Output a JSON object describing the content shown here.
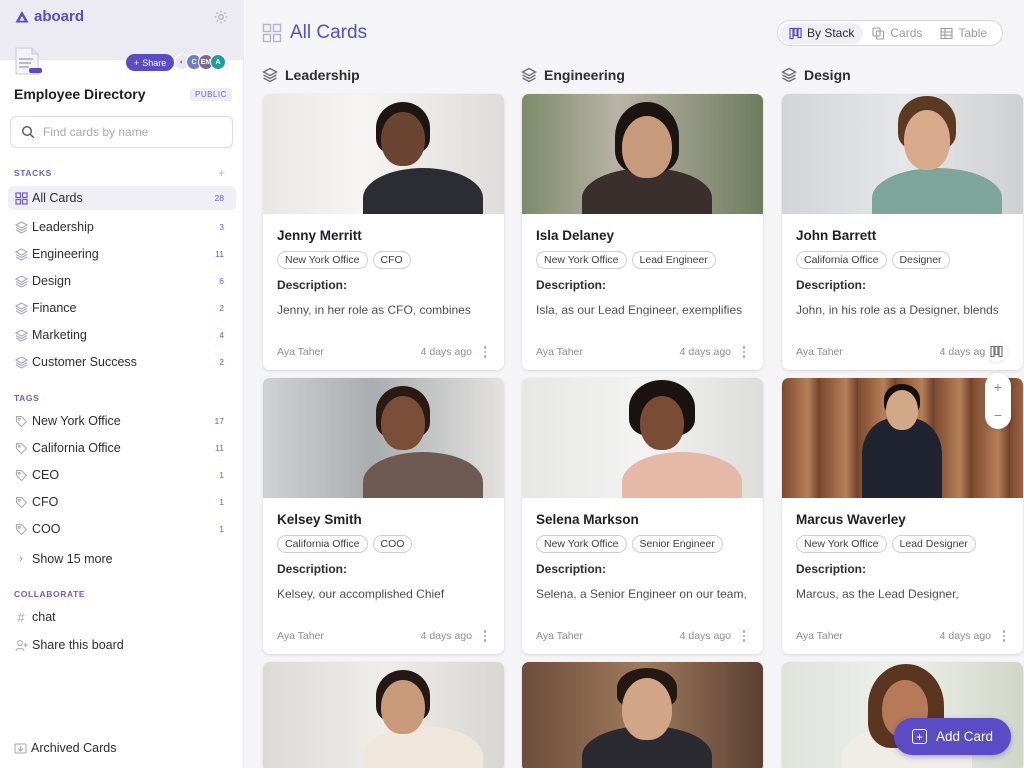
{
  "app": {
    "logo_text": "aboard"
  },
  "board": {
    "title": "Employee Directory",
    "visibility": "PUBLIC",
    "share_label": "Share",
    "avatars": [
      "C",
      "EM",
      "A"
    ]
  },
  "search": {
    "placeholder": "Find cards by name"
  },
  "sidebar": {
    "stacks_label": "STACKS",
    "stacks": [
      {
        "label": "All Cards",
        "count": "28",
        "active": true
      },
      {
        "label": "Leadership",
        "count": "3"
      },
      {
        "label": "Engineering",
        "count": "11"
      },
      {
        "label": "Design",
        "count": "6"
      },
      {
        "label": "Finance",
        "count": "2"
      },
      {
        "label": "Marketing",
        "count": "4"
      },
      {
        "label": "Customer Success",
        "count": "2"
      }
    ],
    "tags_label": "TAGS",
    "tags": [
      {
        "label": "New York Office",
        "count": "17"
      },
      {
        "label": "California Office",
        "count": "11"
      },
      {
        "label": "CEO",
        "count": "1"
      },
      {
        "label": "CFO",
        "count": "1"
      },
      {
        "label": "COO",
        "count": "1"
      }
    ],
    "show_more": "Show 15 more",
    "collaborate_label": "COLLABORATE",
    "collaborate": [
      {
        "label": "chat"
      },
      {
        "label": "Share this board"
      }
    ],
    "archived": "Archived Cards"
  },
  "main": {
    "title": "All Cards",
    "views": [
      {
        "label": "By Stack",
        "active": true
      },
      {
        "label": "Cards"
      },
      {
        "label": "Table"
      }
    ],
    "columns": [
      {
        "title": "Leadership"
      },
      {
        "title": "Engineering"
      },
      {
        "title": "Design"
      }
    ],
    "cards": [
      [
        {
          "name": "Jenny Merritt",
          "tags": [
            "New York Office",
            "CFO"
          ],
          "desc_label": "Description:",
          "desc": "Jenny, in her role as CFO, combines financial prowess with strategic insight",
          "author": "Aya Taher",
          "date": "4 days ago"
        },
        {
          "name": "Kelsey Smith",
          "tags": [
            "California Office",
            "COO"
          ],
          "desc_label": "Description:",
          "desc": "Kelsey, our accomplished Chief Operating Officer, is a driving force",
          "author": "Aya Taher",
          "date": "4 days ago"
        }
      ],
      [
        {
          "name": "Isla Delaney",
          "tags": [
            "New York Office",
            "Lead Engineer"
          ],
          "desc_label": "Description:",
          "desc": "Isla, as our Lead Engineer, exemplifies technical expertise and visionary",
          "author": "Aya Taher",
          "date": "4 days ago"
        },
        {
          "name": "Selena Markson",
          "tags": [
            "New York Office",
            "Senior Engineer"
          ],
          "desc_label": "Description:",
          "desc": "Selena, a Senior Engineer on our team, brings a wealth of technical expertise",
          "author": "Aya Taher",
          "date": "4 days ago"
        }
      ],
      [
        {
          "name": "John Barrett",
          "tags": [
            "California Office",
            "Designer"
          ],
          "desc_label": "Description:",
          "desc": "John, in his role as a Designer, blends creative thinking with a meticulous",
          "author": "Aya Taher",
          "date": "4 days ago"
        },
        {
          "name": "Marcus Waverley",
          "tags": [
            "New York Office",
            "Lead Designer"
          ],
          "desc_label": "Description:",
          "desc": "Marcus, as the Lead Designer, exemplifies a balance of artistic insight",
          "author": "Aya Taher",
          "date": "4 days ago"
        }
      ]
    ],
    "add_card": "Add Card"
  },
  "colors": {
    "accent": "#5b4bc4",
    "accent_text": "#5a4cc7",
    "sidebar_top": "#ecebf4"
  }
}
